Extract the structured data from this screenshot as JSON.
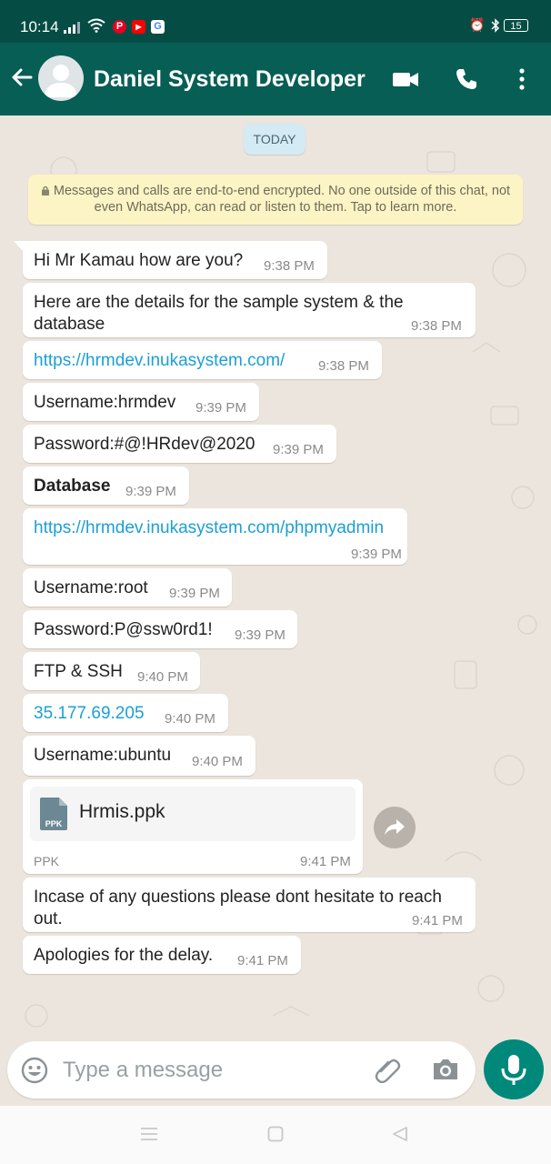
{
  "status_bar": {
    "time": "10:14",
    "battery": "15",
    "colors": {
      "pinterest": "#e60023",
      "youtube": "#ff0000",
      "google": "#ffffff"
    }
  },
  "header": {
    "contact_name": "Daniel System Developer",
    "icons": [
      "arrow-back-icon",
      "avatar",
      "video-call-icon",
      "phone-icon",
      "more-vert-icon"
    ]
  },
  "chat": {
    "date_chip": "TODAY",
    "encryption_notice": "Messages and calls are end-to-end encrypted. No one outside of this chat, not even WhatsApp, can read or listen to them. Tap to learn more.",
    "messages": [
      {
        "text": "Hi Mr Kamau how are you?",
        "time": "9:38 PM"
      },
      {
        "text": "Here are the details for the sample system & the database",
        "time": "9:38 PM"
      },
      {
        "text": "https://hrmdev.inukasystem.com/",
        "time": "9:38 PM",
        "type": "link"
      },
      {
        "text": "Username:hrmdev",
        "time": "9:39 PM"
      },
      {
        "text": "Password:#@!HRdev@2020",
        "time": "9:39 PM"
      },
      {
        "text": "Database",
        "time": "9:39 PM",
        "style": "bold"
      },
      {
        "text": "https://hrmdev.inukasystem.com/phpmyadmin",
        "time": "9:39 PM",
        "type": "link"
      },
      {
        "text": "Username:root",
        "time": "9:39 PM"
      },
      {
        "text": "Password:P@ssw0rd1!",
        "time": "9:39 PM"
      },
      {
        "text": "FTP & SSH",
        "time": "9:40 PM"
      },
      {
        "text": "35.177.69.205",
        "time": "9:40 PM",
        "type": "link"
      },
      {
        "text": "Username:ubuntu",
        "time": "9:40 PM"
      },
      {
        "type": "document",
        "file_name": "Hrmis.ppk",
        "file_type": "PPK",
        "icon_label": "PPK",
        "time": "9:41 PM"
      },
      {
        "text": "Incase of any questions please dont hesitate to reach out.",
        "time": "9:41 PM"
      },
      {
        "text": "Apologies for the delay.",
        "time": "9:41 PM"
      }
    ]
  },
  "composer": {
    "placeholder": "Type a message",
    "icons": [
      "emoji-icon",
      "attach-icon",
      "camera-icon",
      "mic-icon"
    ],
    "colors": {
      "mic_button": "#00897b"
    }
  },
  "colors": {
    "header": "#075e54",
    "status_bar": "#054d44",
    "link": "#1b9fd6",
    "chat_bg": "#ece5dd",
    "notice_bg": "#fdf4c5",
    "date_chip_bg": "#d4eaf4"
  }
}
